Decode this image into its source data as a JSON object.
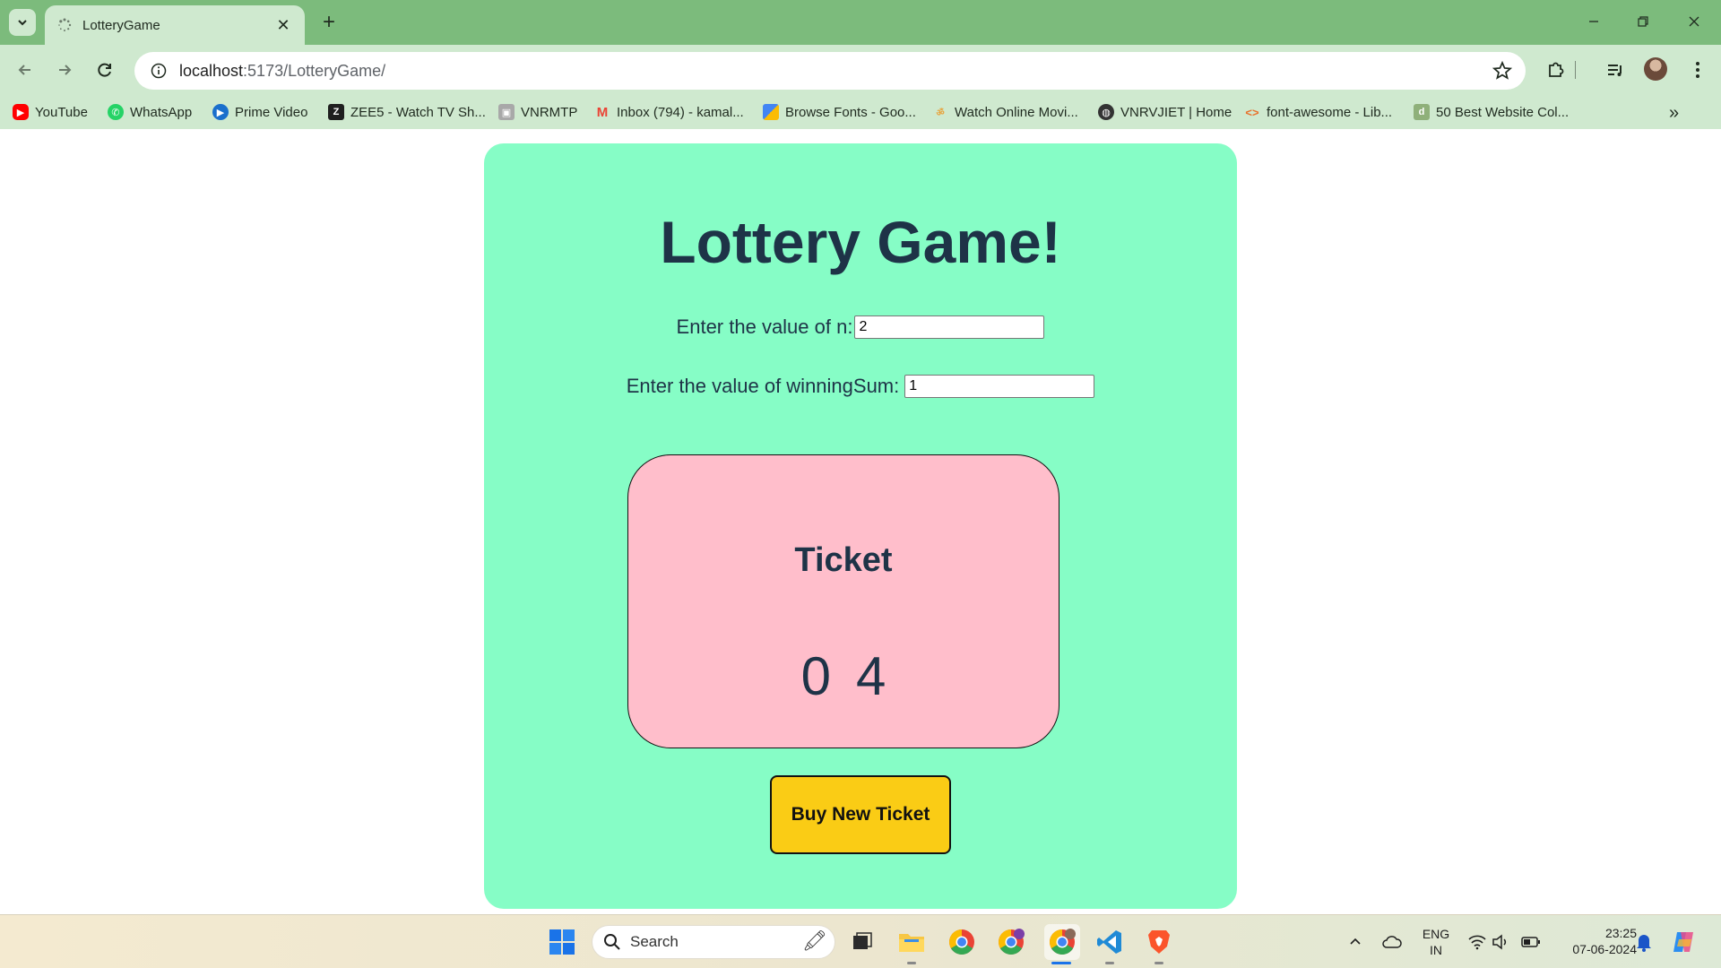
{
  "browser": {
    "tab": {
      "title": "LotteryGame"
    },
    "address": {
      "host": "localhost",
      "rest": ":5173/LotteryGame/"
    },
    "bookmarks": [
      {
        "label": "YouTube",
        "icon": "youtube-icon",
        "color": "#ff0000"
      },
      {
        "label": "WhatsApp",
        "icon": "whatsapp-icon",
        "color": "#25d366"
      },
      {
        "label": "Prime Video",
        "icon": "prime-video-icon",
        "color": "#1a98ff"
      },
      {
        "label": "ZEE5 - Watch TV Sh...",
        "icon": "zee5-icon",
        "color": "#1f1f1f"
      },
      {
        "label": "VNRMTP",
        "icon": "vnrmtp-icon",
        "color": "#8a8a8a"
      },
      {
        "label": "Inbox (794) - kamal...",
        "icon": "gmail-icon",
        "color": "#ea4335"
      },
      {
        "label": "Browse Fonts - Goo...",
        "icon": "google-fonts-icon",
        "color": "#4285f4"
      },
      {
        "label": "Watch Online Movi...",
        "icon": "movies-icon",
        "color": "#e8a23a"
      },
      {
        "label": "VNRVJIET | Home",
        "icon": "globe-icon",
        "color": "#333333"
      },
      {
        "label": "font-awesome - Lib...",
        "icon": "code-icon",
        "color": "#e8702a"
      },
      {
        "label": "50 Best Website Col...",
        "icon": "website-icon",
        "color": "#8fb07a"
      }
    ]
  },
  "page": {
    "title": "Lottery Game!",
    "n_label": "Enter the value of n:",
    "n_value": "2",
    "winning_label": "Enter the value of winningSum:",
    "winning_value": "1",
    "ticket": {
      "title": "Ticket",
      "numbers": [
        "0",
        "4"
      ]
    },
    "buy_button": "Buy New Ticket"
  },
  "taskbar": {
    "search_label": "Search",
    "lang_line1": "ENG",
    "lang_line2": "IN",
    "time": "23:25",
    "date": "07-06-2024"
  },
  "colors": {
    "card": "#86fdc6",
    "ticket": "#ffbecb",
    "button": "#facc15",
    "text": "#1e3347",
    "chrome": "#cfe9cf"
  }
}
